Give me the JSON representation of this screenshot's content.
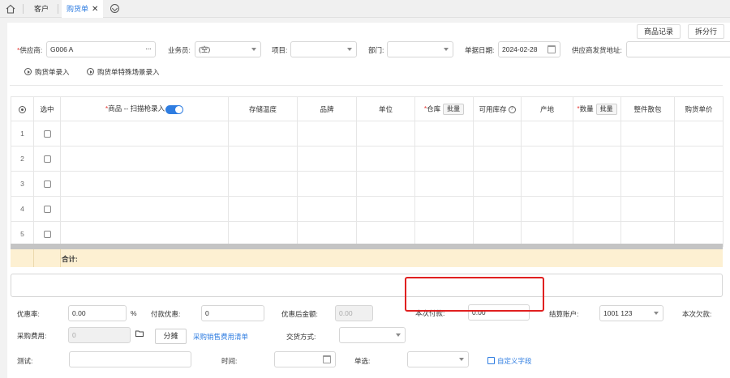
{
  "tabs": {
    "home_icon": "home-icon",
    "items": [
      {
        "label": "客户"
      },
      {
        "label": "购货单",
        "close": "✕"
      }
    ],
    "more_icon": "chevron-circle-icon"
  },
  "toolbar": {
    "product_record": "商品记录",
    "split_row": "拆分行"
  },
  "header": {
    "supplier_label": "供应商:",
    "supplier_value": "G006 A",
    "salesman_label": "业务员:",
    "salesman_value": "(空)",
    "project_label": "项目:",
    "project_value": "",
    "dept_label": "部门:",
    "dept_value": "",
    "date_label": "单据日期:",
    "date_value": "2024-02-28",
    "ship_addr_label": "供应商发货地址:",
    "ship_addr_value": ""
  },
  "actions": {
    "entry": "购货单录入",
    "special_entry": "购货单特殊场景录入"
  },
  "grid": {
    "columns": {
      "select": "选中",
      "product": "商品 -- 扫描枪录入",
      "temp": "存储温度",
      "brand": "品牌",
      "unit": "单位",
      "warehouse": "仓库",
      "batch": "批量",
      "stock": "可用库存",
      "origin": "产地",
      "qty": "数量",
      "qty_batch": "批量",
      "pack": "整件散包",
      "price": "购货单价"
    },
    "rows": [
      "1",
      "2",
      "3",
      "4",
      "5"
    ],
    "total_label": "合计:"
  },
  "footer": {
    "discount_rate_label": "优惠率:",
    "discount_rate_value": "0.00",
    "percent": "%",
    "pay_discount_label": "付款优惠:",
    "pay_discount_value": "0",
    "after_discount_label": "优惠后金额:",
    "after_discount_value": "0.00",
    "this_payment_label": "本次付款:",
    "this_payment_value": "0.00",
    "account_label": "结算账户:",
    "account_value": "1001 123",
    "this_debt_label": "本次欠款:",
    "purchase_fee_label": "采购费用:",
    "purchase_fee_value": "0",
    "share_button": "分摊",
    "fee_list_link": "采购销售费用清单",
    "delivery_label": "交货方式:",
    "delivery_value": "",
    "test_label": "测试:",
    "test_value": "",
    "time_label": "时间:",
    "time_value": "",
    "radio_label": "单选:",
    "radio_value": "",
    "custom_field_link": "自定义字段"
  },
  "colors": {
    "accent": "#2f7de1",
    "required": "#e53935",
    "highlight": "#e02020",
    "total_row": "#fdf0d2"
  }
}
